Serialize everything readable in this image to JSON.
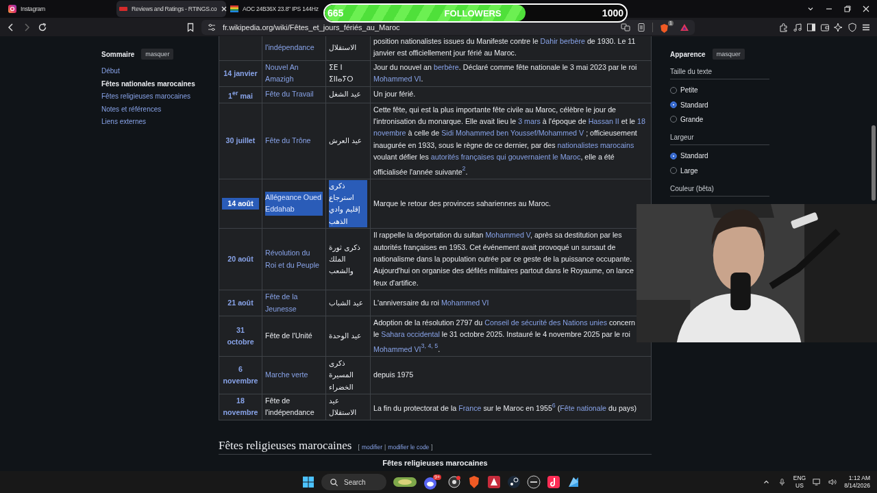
{
  "browser": {
    "tabs": [
      {
        "title": "Instagram",
        "kind": "gradient",
        "hovered": false
      },
      {
        "title": "Reviews and Ratings - RTINGS.co",
        "kind": "red",
        "hovered": true
      },
      {
        "title": "AOC 24B36X 23.8\" IPS 144Hz",
        "kind": "stripes",
        "hovered": false
      }
    ],
    "url": "fr.wikipedia.org/wiki/Fêtes_et_jours_fériés_au_Maroc",
    "shield_count": "1"
  },
  "overlay": {
    "current": "665",
    "label": "FOLLOWERS",
    "goal": "1000",
    "level": 0.665
  },
  "sidebar": {
    "title": "Sommaire",
    "hide_button": "masquer",
    "items": [
      {
        "label": "Début",
        "selected": false
      },
      {
        "label": "Fêtes nationales marocaines",
        "selected": true
      },
      {
        "label": "Fêtes religieuses marocaines",
        "selected": false
      },
      {
        "label": "Notes et références",
        "selected": false
      },
      {
        "label": "Liens externes",
        "selected": false
      }
    ]
  },
  "table": {
    "rows": [
      {
        "name": {
          "text": "l'indépendance",
          "link": true
        },
        "native": "الاستقلال",
        "highlighted": false,
        "description": [
          {
            "t": "position nationalistes issues du Manifeste contre le ",
            "link": false
          },
          {
            "t": "Dahir berbère",
            "link": true
          },
          {
            "t": " de 1930. Le 11 janvier est officiellement jour férié au Maroc.",
            "link": false
          }
        ]
      },
      {
        "date": "14 janvier",
        "name": {
          "text": "Nouvel An Amazigh",
          "link": true
        },
        "native": "ⵉⴹ ⵏ ⵉⵏⵏⴰⵢⵔ",
        "highlighted": false,
        "description": [
          {
            "t": "Jour du nouvel an ",
            "link": false
          },
          {
            "t": "berbère",
            "link": true
          },
          {
            "t": ". Déclaré comme fête nationale le 3 mai 2023 par le roi ",
            "link": false
          },
          {
            "t": "Mohammed VI",
            "link": true
          },
          {
            "t": ".",
            "link": false
          }
        ]
      },
      {
        "date": "1$^{er}$ mai",
        "name": {
          "text": "Fête du Travail",
          "link": true
        },
        "native": "عيد الشغل",
        "highlighted": false,
        "description": [
          {
            "t": "Un jour férié.",
            "link": false
          }
        ]
      },
      {
        "date": "30 juillet",
        "name": {
          "text": "Fête du Trône",
          "link": true
        },
        "native": "عيد العرش",
        "highlighted": false,
        "description": [
          {
            "t": "Cette fête, qui est la plus importante fête civile au Maroc, célèbre le jour de l'intronisation du monarque. Elle avait lieu le ",
            "link": false
          },
          {
            "t": "3 mars",
            "link": true
          },
          {
            "t": " à l'époque de ",
            "link": false
          },
          {
            "t": "Hassan II",
            "link": true
          },
          {
            "t": " et le ",
            "link": false
          },
          {
            "t": "18",
            "link": true
          },
          {
            "t": "novembre",
            "link": true,
            "space_before": true
          },
          {
            "t": " à celle de ",
            "link": false
          },
          {
            "t": "Sidi Mohammed ben Youssef/Mohammed V",
            "link": true
          },
          {
            "t": " ; officieusement inaugurée en 1933, sous le règne de ce dernier, par des ",
            "link": false
          },
          {
            "t": "nationalistes marocains",
            "link": true
          },
          {
            "t": " voulant défier les ",
            "link": false
          },
          {
            "t": "autorités françaises qui gouvernaient le Maroc",
            "link": true
          },
          {
            "t": ", elle a été officialisée l'année suivante",
            "link": false
          },
          {
            "t": "$^{2}$",
            "link": true
          },
          {
            "t": ".",
            "link": false
          }
        ]
      },
      {
        "date": "14 août",
        "name": {
          "text": "Allégeance Oued Eddahab",
          "link": true
        },
        "native": "ذكرى استرجاع إقليم وادي الذهب",
        "highlighted": true,
        "description": [
          {
            "t": "Marque le retour des provinces sahariennes au Maroc.",
            "link": false
          }
        ]
      },
      {
        "date": "20 août",
        "name": {
          "text": "Révolution du Roi et du Peuple",
          "link": true
        },
        "native": "ذكرى ثورة الملك والشعب",
        "highlighted": false,
        "description": [
          {
            "t": "Il rappelle la déportation du sultan ",
            "link": false
          },
          {
            "t": "Mohammed V",
            "link": true
          },
          {
            "t": ", après sa destitution par les autorités françaises en 1953. Cet événement avait provoqué un sursaut de nationalisme dans la population outrée par ce geste de la puissance occupante. Aujourd'hui on organise des défilés militaires partout dans le Royaume, on lance feux d'artifice.",
            "link": false
          }
        ]
      },
      {
        "date": "21 août",
        "name": {
          "text": "Fête de la Jeunesse",
          "link": true
        },
        "native": "عيد الشباب",
        "highlighted": false,
        "description": [
          {
            "t": "L'anniversaire du roi ",
            "link": false
          },
          {
            "t": "Mohammed VI",
            "link": true
          }
        ]
      },
      {
        "date": "31 octobre",
        "name": {
          "text": "Fête de l'Unité",
          "link": false
        },
        "native": "عيد الوحدة",
        "highlighted": false,
        "description": [
          {
            "t": "Adoption de la résolution 2797 du ",
            "link": false
          },
          {
            "t": "Conseil de sécurité des Nations unies",
            "link": true
          },
          {
            "t": " concern",
            "link": false
          },
          {
            "t": "le ",
            "link": false,
            "break_before": true
          },
          {
            "t": "Sahara occidental",
            "link": true
          },
          {
            "t": " le 31 octobre 2025. Instauré le 4 novembre 2025 par le roi ",
            "link": false
          },
          {
            "t": "Mohammed VI",
            "link": true
          },
          {
            "t": "$^{3, 4, 5}$",
            "link": true
          },
          {
            "t": ".",
            "link": false
          }
        ]
      },
      {
        "date": "6 novembre",
        "name": {
          "text": "Marche verte",
          "link": true
        },
        "native": "ذكرى المسيرة الخضراء",
        "highlighted": false,
        "description": [
          {
            "t": "depuis 1975",
            "link": false
          }
        ]
      },
      {
        "date": "18 novembre",
        "name": {
          "text": "Fête de l'indépendance",
          "link": false
        },
        "native": "عيد الاستقلال",
        "highlighted": false,
        "description": [
          {
            "t": "La fin du protectorat de la ",
            "link": false
          },
          {
            "t": "France",
            "link": true
          },
          {
            "t": " sur le Maroc en 1955",
            "link": false
          },
          {
            "t": "$^{6}$",
            "link": true
          },
          {
            "t": " (",
            "link": false
          },
          {
            "t": "Fête nationale",
            "link": true
          },
          {
            "t": " du pays)",
            "link": false
          }
        ]
      }
    ]
  },
  "next_section": {
    "heading": "Fêtes religieuses marocaines",
    "edit_open": "[",
    "edit_links": [
      "modifier",
      "modifier le code"
    ],
    "edit_separator": "|",
    "edit_close": "]",
    "caption": "Fêtes religieuses marocaines"
  },
  "appearance": {
    "title": "Apparence",
    "hide_button": "masquer",
    "groups": [
      {
        "label": "Taille du texte",
        "options": [
          {
            "label": "Petite",
            "selected": false
          },
          {
            "label": "Standard",
            "selected": true
          },
          {
            "label": "Grande",
            "selected": false
          }
        ]
      },
      {
        "label": "Largeur",
        "options": [
          {
            "label": "Standard",
            "selected": true
          },
          {
            "label": "Large",
            "selected": false
          }
        ]
      },
      {
        "label": "Couleur (bêta)"
      }
    ]
  },
  "taskbar": {
    "search_placeholder": "Search",
    "chat_badge": "9+",
    "language": "ENG",
    "region": "US",
    "time": "1:12 AM",
    "date": "8/14/2026"
  }
}
